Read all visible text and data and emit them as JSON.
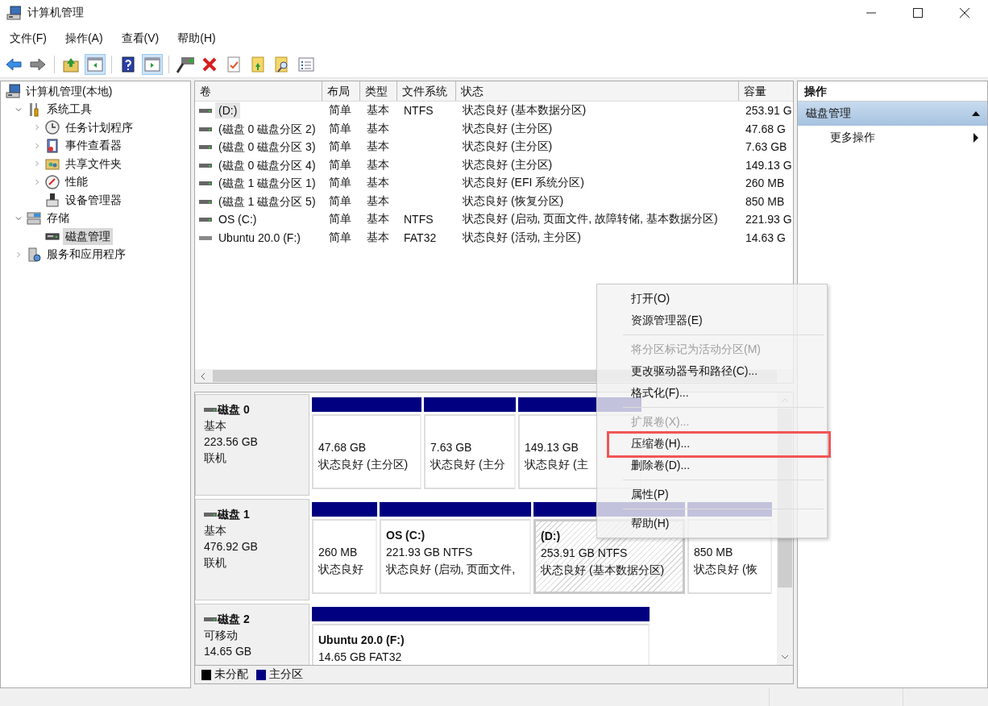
{
  "window": {
    "title": "计算机管理"
  },
  "menu_bar": [
    "文件(F)",
    "操作(A)",
    "查看(V)",
    "帮助(H)"
  ],
  "toolbar": [
    [
      {
        "kind": "back",
        "on": false
      },
      {
        "kind": "forward",
        "on": false
      }
    ],
    [
      {
        "kind": "up",
        "on": false
      },
      {
        "kind": "tree",
        "on": true
      }
    ],
    [
      {
        "kind": "help",
        "on": false
      },
      {
        "kind": "pane",
        "on": true
      }
    ],
    [
      {
        "kind": "connect",
        "on": false
      },
      {
        "kind": "delete",
        "on": false
      },
      {
        "kind": "properties",
        "on": false
      },
      {
        "kind": "export",
        "on": false
      },
      {
        "kind": "find",
        "on": false
      },
      {
        "kind": "list",
        "on": false
      }
    ]
  ],
  "tree": [
    {
      "label": "计算机管理(本地)",
      "kind": "computer",
      "selected": false,
      "children": [
        {
          "label": "系统工具",
          "kind": "tools",
          "expanded": true,
          "selected": false,
          "children": [
            {
              "label": "任务计划程序",
              "kind": "clock",
              "expanded": false,
              "selected": false
            },
            {
              "label": "事件查看器",
              "kind": "log",
              "expanded": false,
              "selected": false
            },
            {
              "label": "共享文件夹",
              "kind": "share",
              "expanded": false,
              "selected": false
            },
            {
              "label": "性能",
              "kind": "gauge",
              "expanded": false,
              "selected": false
            },
            {
              "label": "设备管理器",
              "kind": "device",
              "selected": false
            }
          ]
        },
        {
          "label": "存储",
          "kind": "storage",
          "expanded": true,
          "selected": false,
          "children": [
            {
              "label": "磁盘管理",
              "kind": "disk",
              "selected": true
            }
          ]
        },
        {
          "label": "服务和应用程序",
          "kind": "services",
          "expanded": false,
          "selected": false
        }
      ]
    }
  ],
  "volume_table": {
    "columns": [
      "卷",
      "布局",
      "类型",
      "文件系统",
      "状态",
      "容量"
    ],
    "rows": [
      {
        "kind": "fixed",
        "selected": true,
        "cells": [
          "(D:)",
          "简单",
          "基本",
          "NTFS",
          "状态良好 (基本数据分区)",
          "253.91 G"
        ]
      },
      {
        "kind": "fixed",
        "selected": false,
        "cells": [
          "(磁盘 0 磁盘分区 2)",
          "简单",
          "基本",
          "",
          "状态良好 (主分区)",
          "47.68 G"
        ]
      },
      {
        "kind": "fixed",
        "selected": false,
        "cells": [
          "(磁盘 0 磁盘分区 3)",
          "简单",
          "基本",
          "",
          "状态良好 (主分区)",
          "7.63 GB"
        ]
      },
      {
        "kind": "fixed",
        "selected": false,
        "cells": [
          "(磁盘 0 磁盘分区 4)",
          "简单",
          "基本",
          "",
          "状态良好 (主分区)",
          "149.13 G"
        ]
      },
      {
        "kind": "fixed",
        "selected": false,
        "cells": [
          "(磁盘 1 磁盘分区 1)",
          "简单",
          "基本",
          "",
          "状态良好 (EFI 系统分区)",
          "260 MB"
        ]
      },
      {
        "kind": "fixed",
        "selected": false,
        "cells": [
          "(磁盘 1 磁盘分区 5)",
          "简单",
          "基本",
          "",
          "状态良好 (恢复分区)",
          "850 MB"
        ]
      },
      {
        "kind": "fixed",
        "selected": false,
        "cells": [
          "OS (C:)",
          "简单",
          "基本",
          "NTFS",
          "状态良好 (启动, 页面文件, 故障转储, 基本数据分区)",
          "221.93 G"
        ]
      },
      {
        "kind": "removable",
        "selected": false,
        "cells": [
          "Ubuntu 20.0 (F:)",
          "简单",
          "基本",
          "FAT32",
          "状态良好 (活动, 主分区)",
          "14.63 G"
        ]
      }
    ]
  },
  "disks": [
    {
      "name": "磁盘 0",
      "type": "基本",
      "size": "223.56 GB",
      "status": "联机",
      "partitions": [
        {
          "kind": "primary",
          "selected": false,
          "size": "47.68 GB",
          "status": "状态良好 (主分区)"
        },
        {
          "kind": "primary",
          "selected": false,
          "size": "7.63 GB",
          "status": "状态良好 (主分"
        },
        {
          "kind": "primary",
          "selected": false,
          "size": "149.13 GB",
          "status": "状态良好 (主"
        }
      ]
    },
    {
      "name": "磁盘 1",
      "type": "基本",
      "size": "476.92 GB",
      "status": "联机",
      "partitions": [
        {
          "kind": "primary",
          "selected": false,
          "size": "260 MB",
          "status": "状态良好"
        },
        {
          "kind": "primary",
          "selected": false,
          "label": "OS  (C:)",
          "size": "221.93 GB NTFS",
          "status": "状态良好 (启动, 页面文件,"
        },
        {
          "kind": "primary",
          "selected": true,
          "label": "(D:)",
          "size": "253.91 GB NTFS",
          "status": "状态良好 (基本数据分区)"
        },
        {
          "kind": "primary",
          "selected": false,
          "size": "850 MB",
          "status": "状态良好 (恢"
        }
      ]
    },
    {
      "name": "磁盘 2",
      "type": "可移动",
      "size": "14.65 GB",
      "partitions": [
        {
          "kind": "primary",
          "selected": false,
          "label": "Ubuntu 20.0  (F:)",
          "size": "14.65 GB FAT32"
        }
      ]
    }
  ],
  "legend": [
    {
      "label": "未分配",
      "color": "#000000"
    },
    {
      "label": "主分区",
      "color": "#000080"
    }
  ],
  "actions": {
    "title": "操作",
    "sections": [
      {
        "label": "磁盘管理",
        "expanded": true,
        "items": [
          "更多操作"
        ]
      }
    ]
  },
  "context_menu": {
    "items": [
      {
        "kind": "item",
        "label": "打开(O)",
        "disabled": false,
        "annotated": false
      },
      {
        "kind": "item",
        "label": "资源管理器(E)",
        "disabled": false,
        "annotated": false
      },
      {
        "kind": "separator"
      },
      {
        "kind": "item",
        "label": "将分区标记为活动分区(M)",
        "disabled": true,
        "annotated": false
      },
      {
        "kind": "item",
        "label": "更改驱动器号和路径(C)...",
        "disabled": false,
        "annotated": false
      },
      {
        "kind": "item",
        "label": "格式化(F)...",
        "disabled": false,
        "annotated": false
      },
      {
        "kind": "separator"
      },
      {
        "kind": "item",
        "label": "扩展卷(X)...",
        "disabled": true,
        "annotated": false
      },
      {
        "kind": "item",
        "label": "压缩卷(H)...",
        "disabled": false,
        "annotated": true
      },
      {
        "kind": "item",
        "label": "删除卷(D)...",
        "disabled": false,
        "annotated": false
      },
      {
        "kind": "separator"
      },
      {
        "kind": "item",
        "label": "属性(P)",
        "disabled": false,
        "annotated": false
      },
      {
        "kind": "separator"
      },
      {
        "kind": "item",
        "label": "帮助(H)",
        "disabled": false,
        "annotated": false
      }
    ]
  }
}
